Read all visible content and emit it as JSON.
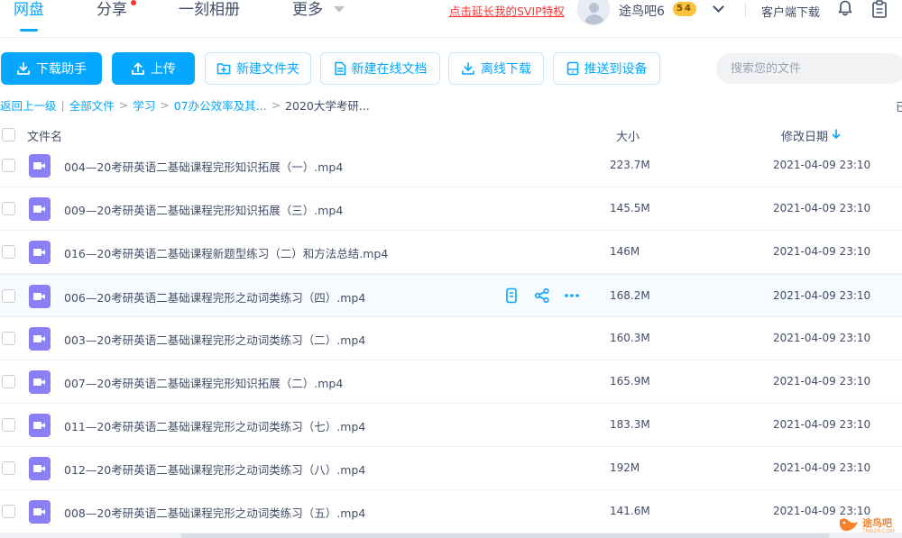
{
  "nav": {
    "tabs": [
      {
        "label": "网盘",
        "active": true
      },
      {
        "label": "分享",
        "active": false
      },
      {
        "label": "一刻相册",
        "active": false
      },
      {
        "label": "更多",
        "active": false
      }
    ],
    "svip_link": "点击延长我的SVIP特权",
    "username": "途鸟吧6",
    "level_badge": "54",
    "client_download": "客户端下载",
    "accent_color": "#06a7ff",
    "alert_color": "#ff3333"
  },
  "toolbar": {
    "download_helper": "下载助手",
    "upload": "上传",
    "new_folder": "新建文件夹",
    "new_online_doc": "新建在线文档",
    "offline_download": "离线下载",
    "push_to_device": "推送到设备",
    "search_placeholder": "搜索您的文件"
  },
  "breadcrumb": {
    "back": "返回上一级",
    "items": [
      "全部文件",
      "学习",
      "07办公效率及其...",
      "2020大学考研..."
    ],
    "right_truncated": "已"
  },
  "table": {
    "columns": {
      "name": "文件名",
      "size": "大小",
      "modified": "修改日期"
    },
    "sort": {
      "column": "modified",
      "direction": "down"
    },
    "rows": [
      {
        "name": "004—20考研英语二基础课程完形知识拓展（一）.mp4",
        "size": "223.7M",
        "modified": "2021-04-09 23:10",
        "icon": "video-file-icon"
      },
      {
        "name": "009—20考研英语二基础课程完形知识拓展（三）.mp4",
        "size": "145.5M",
        "modified": "2021-04-09 23:10",
        "icon": "video-file-icon"
      },
      {
        "name": "016—20考研英语二基础课程新题型练习（二）和方法总结.mp4",
        "size": "146M",
        "modified": "2021-04-09 23:10",
        "icon": "video-file-icon"
      },
      {
        "name": "006—20考研英语二基础课程完形之动词类练习（四）.mp4",
        "size": "168.2M",
        "modified": "2021-04-09 23:10",
        "icon": "video-file-icon",
        "hovered": true
      },
      {
        "name": "003—20考研英语二基础课程完形之动词类练习（二）.mp4",
        "size": "160.3M",
        "modified": "2021-04-09 23:10",
        "icon": "video-file-icon"
      },
      {
        "name": "007—20考研英语二基础课程完形知识拓展（二）.mp4",
        "size": "165.9M",
        "modified": "2021-04-09 23:10",
        "icon": "video-file-icon"
      },
      {
        "name": "011—20考研英语二基础课程完形之动词类练习（七）.mp4",
        "size": "183.3M",
        "modified": "2021-04-09 23:10",
        "icon": "video-file-icon"
      },
      {
        "name": "012—20考研英语二基础课程完形之动词类练习（八）.mp4",
        "size": "192M",
        "modified": "2021-04-09 23:10",
        "icon": "video-file-icon"
      },
      {
        "name": "008—20考研英语二基础课程完形之动词类练习（五）.mp4",
        "size": "141.6M",
        "modified": "2021-04-09 23:10",
        "icon": "video-file-icon"
      }
    ],
    "row_actions": [
      "phone-push-icon",
      "share-icon",
      "more-icon"
    ]
  },
  "watermark": {
    "text": "途鸟吧",
    "sub": "TNB28.COM"
  }
}
